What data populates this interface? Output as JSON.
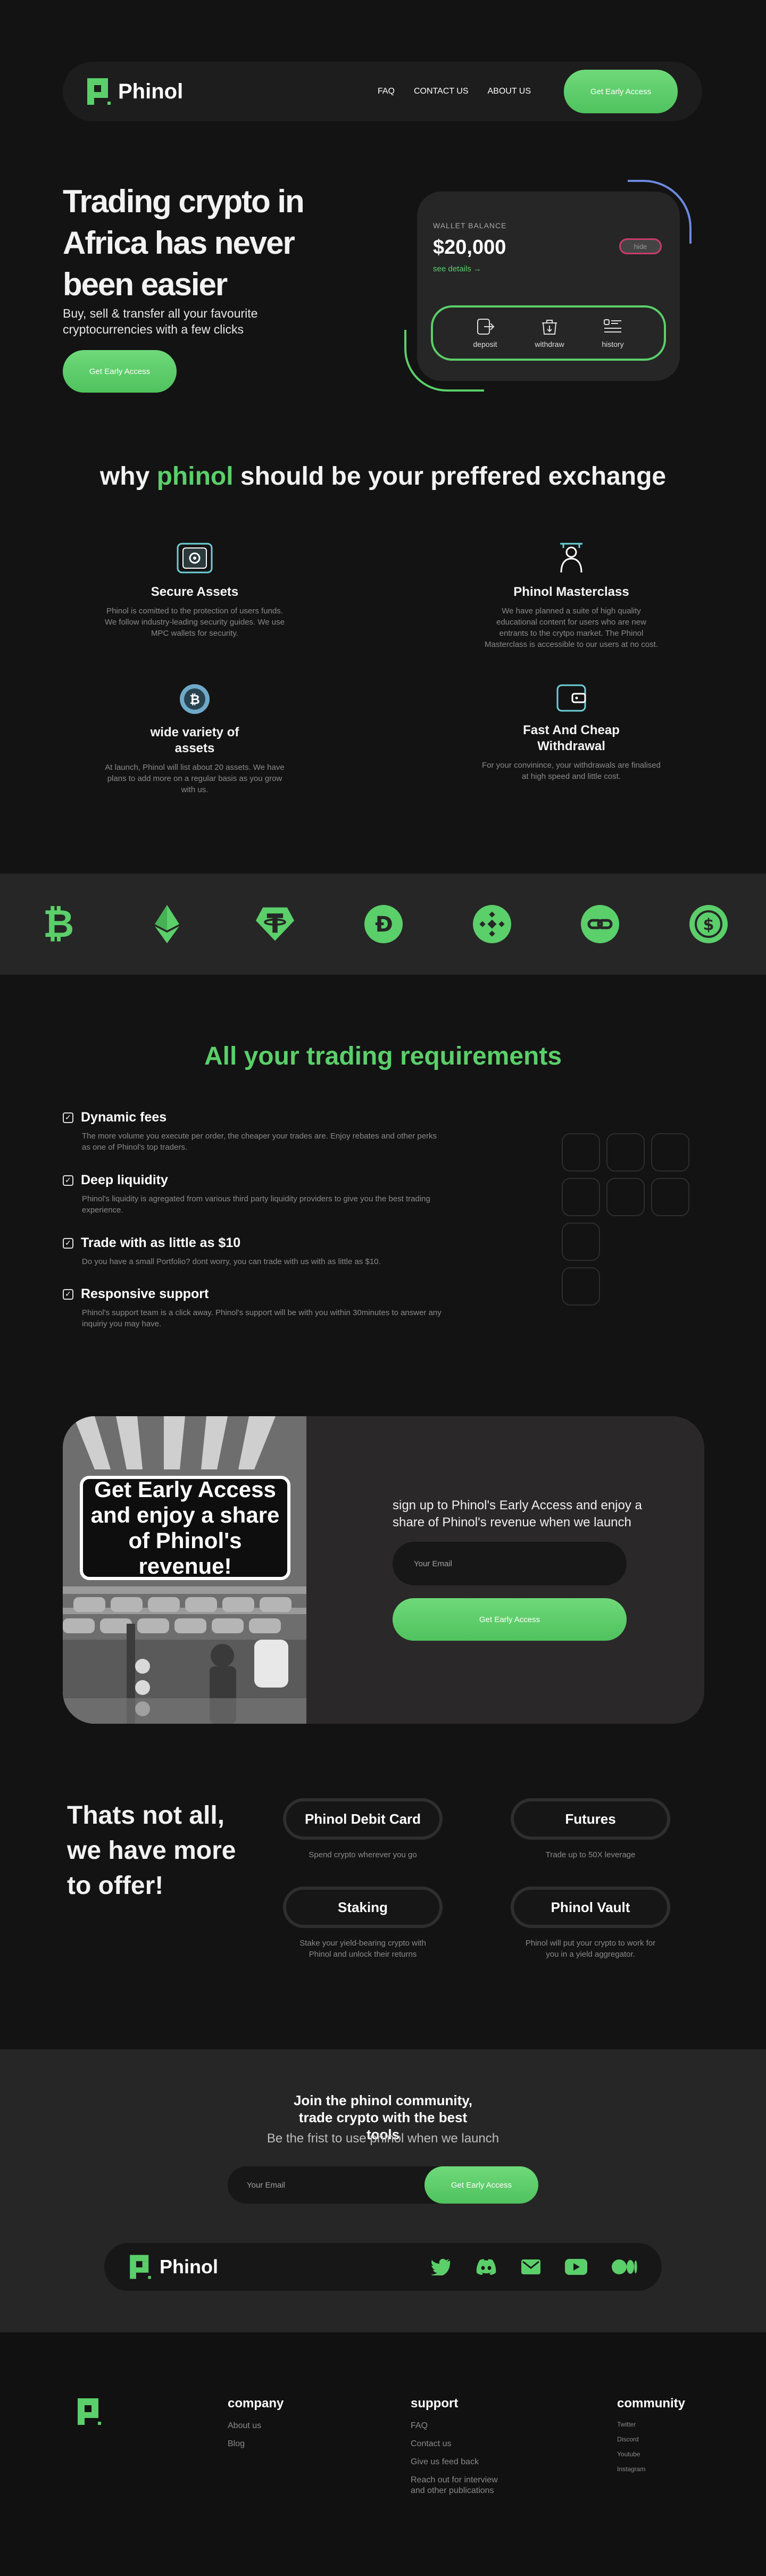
{
  "brand": {
    "name": "Phinol"
  },
  "colors": {
    "accent": "#5bcf6a",
    "background": "#131313",
    "panel": "#262626",
    "blue_accent": "#6c8ae0"
  },
  "nav": {
    "links": [
      "FAQ",
      "CONTACT US",
      "ABOUT US"
    ],
    "cta": "Get Early Access"
  },
  "hero": {
    "title": "Trading crypto in Africa has never been easier",
    "subtitle": "Buy, sell & transfer all your favourite cryptocurrencies with a few clicks",
    "cta": "Get Early Access"
  },
  "wallet": {
    "label": "WALLET BALANCE",
    "amount": "$20,000",
    "see_details": "see details →",
    "hide": "hide",
    "actions": [
      {
        "label": "deposit",
        "icon": "deposit-icon"
      },
      {
        "label": "withdraw",
        "icon": "withdraw-icon"
      },
      {
        "label": "history",
        "icon": "history-icon"
      }
    ]
  },
  "why": {
    "title_pre": "why ",
    "title_brand": "phinol",
    "title_post": " should be your preffered exchange",
    "features": [
      {
        "title": "Secure Assets",
        "text": "Phinol is comitted to the protection of users funds. We follow industry-leading security guides. We use MPC wallets for security.",
        "icon": "safe-icon"
      },
      {
        "title": "Phinol Masterclass",
        "text": "We have planned a suite of high quality educational content for users who are new entrants to the crytpo market.  The Phinol Masterclass is accessible to our users at no cost.",
        "icon": "teacher-icon"
      },
      {
        "title": "wide variety of assets",
        "text": "At launch, Phinol will list about 20 assets. We have plans to add more on a regular basis as you grow with us.",
        "icon": "bitcoin-icon"
      },
      {
        "title": "Fast And Cheap Withdrawal",
        "text": "For your convinince, your withdrawals are finalised at high speed and little cost.",
        "icon": "wallet-icon"
      }
    ]
  },
  "coins": [
    "bitcoin-icon",
    "ethereum-icon",
    "tether-icon",
    "dogecoin-icon",
    "binance-icon",
    "chainlink-icon",
    "usdcoin-icon"
  ],
  "requirements": {
    "title": "All your trading requirements",
    "items": [
      {
        "title": "Dynamic fees",
        "text": "The more volume you execute per order, the cheaper your trades are. Enjoy rebates and other perks as one of Phinol's top traders."
      },
      {
        "title": "Deep liquidity",
        "text": "Phinol's liquidity is agregated from various third party liquidity providers to give you the best trading experience."
      },
      {
        "title": "Trade with as little as $10",
        "text": "Do you have a small Portfolio? dont worry, you can trade with us with as little as $10."
      },
      {
        "title": "Responsive support",
        "text": "Phinol's support team is a click away. Phinol's support will be with you within 30minutes to answer any inquiriy you may have."
      }
    ]
  },
  "early_access": {
    "sign": "Get Early Access and enjoy a share of Phinol's revenue!",
    "text": "sign up to Phinol's Early Access and enjoy a share of Phinol's revenue when we launch",
    "placeholder": "Your Email",
    "cta": "Get Early Access"
  },
  "more": {
    "title": "Thats not all, we have more to offer!",
    "items": [
      {
        "title": "Phinol Debit Card",
        "text": "Spend crypto wherever you go"
      },
      {
        "title": "Futures",
        "text": "Trade up to 50X leverage"
      },
      {
        "title": "Staking",
        "text": "Stake your yield-bearing crypto with Phinol and unlock their returns"
      },
      {
        "title": "Phinol Vault",
        "text": "Phinol will put your crypto to work for you in a yield aggregator."
      }
    ]
  },
  "join": {
    "title": "Join the phinol community, trade crypto with the best tools",
    "subtitle": "Be the frist to use phinol when we launch",
    "placeholder": "Your Email",
    "cta": "Get Early Access",
    "socials": [
      "twitter-icon",
      "discord-icon",
      "email-icon",
      "youtube-icon",
      "medium-icon"
    ]
  },
  "footer": {
    "company": {
      "title": "company",
      "links": [
        "About us",
        "Blog"
      ]
    },
    "support": {
      "title": "support",
      "links": [
        "FAQ",
        "Contact us",
        "Give us feed back",
        "Reach out for interview and other publications"
      ]
    },
    "community": {
      "title": "community",
      "links": [
        "Twitter",
        "Discord",
        "Youtube",
        "Instagram"
      ]
    }
  }
}
